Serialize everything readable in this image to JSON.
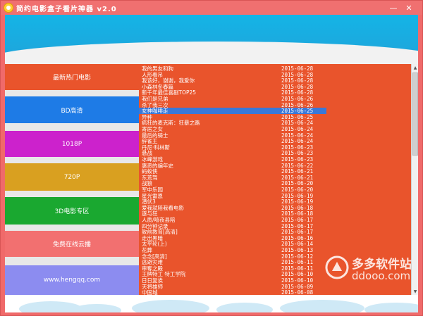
{
  "window": {
    "title": "简约电影盒子看片神器 v2.0"
  },
  "colors": {
    "titlebar": "#f07070",
    "header": "#14b4e6",
    "list_bg": "#e9542c",
    "selected": "#3a78d8"
  },
  "categories": [
    {
      "label": "最新热门电影",
      "color": "#e9542c"
    },
    {
      "label": "BD高清",
      "color": "#1e7be6"
    },
    {
      "label": "1018P",
      "color": "#cc22cc"
    },
    {
      "label": "720P",
      "color": "#d9a020"
    },
    {
      "label": "3D电影专区",
      "color": "#1aa830"
    },
    {
      "label": "免费在线云播",
      "color": "#f27070"
    },
    {
      "label": "www.hengqq.com",
      "color": "#8c8cf0"
    }
  ],
  "movies": [
    {
      "title": "我的男友和狗",
      "date": "2015-06-28"
    },
    {
      "title": "人形看吊",
      "date": "2015-06-28"
    },
    {
      "title": "我该好，谢谢，我爱你",
      "date": "2015-06-28"
    },
    {
      "title": "小森林冬春篇",
      "date": "2015-06-28"
    },
    {
      "title": "新千年最佳喜剧TOP25",
      "date": "2015-06-28"
    },
    {
      "title": "我们是兄弟",
      "date": "2015-06-26"
    },
    {
      "title": "杀了我三次",
      "date": "2015-06-26"
    },
    {
      "title": "女神咖啡走",
      "date": "2015-06-25"
    },
    {
      "title": "异种",
      "date": "2015-06-25"
    },
    {
      "title": "疯狂的麦克斯：狂暴之路",
      "date": "2015-06-24"
    },
    {
      "title": "寄居之女",
      "date": "2015-06-24"
    },
    {
      "title": "最后的骑士",
      "date": "2015-06-24"
    },
    {
      "title": "辞雀王",
      "date": "2015-06-24"
    },
    {
      "title": "丹尼·科林斯",
      "date": "2015-06-23"
    },
    {
      "title": "悬战",
      "date": "2015-06-23"
    },
    {
      "title": "冰峰游戏",
      "date": "2015-06-23"
    },
    {
      "title": "惠恶的编年史",
      "date": "2015-06-22"
    },
    {
      "title": "蚂蚁侠",
      "date": "2015-06-21"
    },
    {
      "title": "东荒驾",
      "date": "2015-06-21"
    },
    {
      "title": "战狼",
      "date": "2015-06-20"
    },
    {
      "title": "军中乐园",
      "date": "2015-06-20"
    },
    {
      "title": "星光雷恩",
      "date": "2015-06-19"
    },
    {
      "title": "潜伏3",
      "date": "2015-06-19"
    },
    {
      "title": "爱我就陪我看电影",
      "date": "2015-06-18"
    },
    {
      "title": "逐与狂",
      "date": "2015-06-18"
    },
    {
      "title": "人质/嘻夜县陪",
      "date": "2015-06-17"
    },
    {
      "title": "四分钟记录",
      "date": "2015-06-17"
    },
    {
      "title": "致前教育[高清]",
      "date": "2015-06-17"
    },
    {
      "title": "走出黑暗",
      "date": "2015-06-16"
    },
    {
      "title": "太平轮(上)",
      "date": "2015-06-14"
    },
    {
      "title": "花葬",
      "date": "2015-06-13"
    },
    {
      "title": "念念[高清]",
      "date": "2015-06-12"
    },
    {
      "title": "逃避灾难",
      "date": "2015-06-11"
    },
    {
      "title": "审奪之殿",
      "date": "2015-06-11"
    },
    {
      "title": "王牌特工 特工学院",
      "date": "2015-06-10"
    },
    {
      "title": "日日复诶",
      "date": "2015-06-10"
    },
    {
      "title": "天将雄师",
      "date": "2015-06-09"
    },
    {
      "title": "中国城",
      "date": "2015-06-08"
    }
  ],
  "selected_index": 7,
  "scrollbar": {
    "up_icon": "▲",
    "down_icon": "▼"
  },
  "watermark": {
    "name": "多多软件站",
    "url": "ddooo.com"
  },
  "window_buttons": {
    "minimize": "—",
    "close": "✕"
  }
}
